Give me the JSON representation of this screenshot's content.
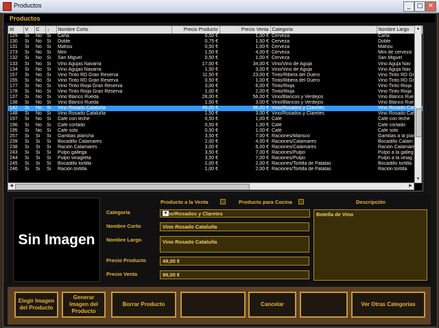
{
  "window": {
    "title": "Productos",
    "min": "_",
    "max": "□",
    "close": "✕"
  },
  "panel": {
    "title": "Productos"
  },
  "table": {
    "headers": [
      "Id",
      "V",
      "C",
      "↓",
      "Nombre Corto",
      "Precio Producto",
      "Precio Venta",
      "Categoria",
      "Nombre Largo"
    ],
    "rows": [
      [
        "129",
        "Si",
        "No",
        "Si",
        "Caña",
        "0,50 €",
        "1,00 €",
        "Cerveza",
        "Caña"
      ],
      [
        "130",
        "Si",
        "No",
        "Si",
        "Doble",
        "0,75 €",
        "1,50 €",
        "Cerveza",
        "Doble"
      ],
      [
        "131",
        "Si",
        "No",
        "Si",
        "Mahou",
        "0,50 €",
        "1,00 €",
        "Cerveza",
        "Mahou"
      ],
      [
        "273",
        "Si",
        "No",
        "Si",
        "Mini",
        "1,50 €",
        "4,00 €",
        "Cerveza",
        "Mini de cerveza"
      ],
      [
        "132",
        "Si",
        "No",
        "Si",
        "San Miguel",
        "0,50 €",
        "1,00 €",
        "Cerveza",
        "San Miguel"
      ],
      [
        "133",
        "Si",
        "No",
        "Si",
        "Vino Agujas Navarra",
        "17,00 €",
        "34,00 €",
        "Vino/Vino de Aguja",
        "Vino Aguja Nav"
      ],
      [
        "134",
        "Si",
        "No",
        "Si",
        "Vino Agujas Navarra",
        "1,50 €",
        "3,00 €",
        "Vino/Vino de Aguja",
        "Vino Aguja Nav"
      ],
      [
        "157",
        "Si",
        "No",
        "Si",
        "Vino Tinto RD Gran Reserva",
        "11,50 €",
        "23,00 €",
        "Tinto/Ribera del Duero",
        "Vino Tinto RD Gr"
      ],
      [
        "155",
        "Si",
        "No",
        "Si",
        "Vino Tinto RD Gran Reserva",
        "0,50 €",
        "1,00 €",
        "Tinto/Ribera del Duero",
        "Vino Tinto RD Gr"
      ],
      [
        "177",
        "Si",
        "No",
        "Si",
        "Vino Tinto Rioja Gran Reserva",
        "3,00 €",
        "6,00 €",
        "Tinto/Rioja",
        "Vino Tinto Rioja"
      ],
      [
        "178",
        "Si",
        "No",
        "Si",
        "Vino Tinto Rioja Gran Reserva",
        "1,00 €",
        "2,00 €",
        "Tinto/Rioja",
        "Vino Tinto Rioja"
      ],
      [
        "137",
        "Si",
        "No",
        "Si",
        "Vino Blanco Rueda",
        "28,00 €",
        "56,00 €",
        "Vino/Blancos y Verdejos",
        "Vino Blanco Rue"
      ],
      [
        "138",
        "Si",
        "No",
        "Si",
        "Vino Blanco Rueda",
        "1,50 €",
        "3,00 €",
        "Vino/Blancos y Verdejos",
        "Vino Blanco Rue"
      ],
      [
        "142",
        "Si",
        "No",
        "Si",
        "Vino Rosado Cataluña",
        "49,00 €",
        "98,00 €",
        "Vino/Rosados y Claretes",
        "Vino Rosado Cat"
      ],
      [
        "148",
        "Si",
        "No",
        "Si",
        "Vino Rosado Cataluña",
        "1,50 €",
        "3,00 €",
        "Vino/Rosados y Claretes",
        "Vino Rosado Cat"
      ],
      [
        "197",
        "Si",
        "No",
        "Si",
        "Cafe con leche",
        "0,50 €",
        "1,00 €",
        "Café",
        "Cafe con leche"
      ],
      [
        "196",
        "Si",
        "No",
        "Si",
        "Cafe cortado",
        "0,50 €",
        "1,00 €",
        "Café",
        "Cafe cortado"
      ],
      [
        "195",
        "Si",
        "No",
        "Si",
        "Cafe solo",
        "0,50 €",
        "1,00 €",
        "Café",
        "Cafe solo"
      ],
      [
        "257",
        "Si",
        "Si",
        "Si",
        "Gambas plancha",
        "3,50 €",
        "7,00 €",
        "Raciones/Marisco",
        "Gambas a la plan"
      ],
      [
        "239",
        "Si",
        "Si",
        "Si",
        "Bocadillo Calamares",
        "2,00 €",
        "4,00 €",
        "Raciones/Calamares",
        "Bocadillo Calam"
      ],
      [
        "238",
        "Si",
        "Si",
        "Si",
        "Ración Calamares",
        "3,00 €",
        "6,00 €",
        "Raciones/Calamares",
        "Ración Calamare"
      ],
      [
        "243",
        "Si",
        "Si",
        "Si",
        "Pulpo gallega",
        "3,50 €",
        "7,00 €",
        "Raciones/Pulpo",
        "Pulpo a la galleg"
      ],
      [
        "244",
        "Si",
        "Si",
        "Si",
        "Pulpo vinagreta",
        "3,50 €",
        "7,00 €",
        "Raciones/Pulpo",
        "Pulpo a la vinag"
      ],
      [
        "245",
        "Si",
        "Si",
        "Si",
        "Bocadillo tortilla",
        "1,00 €",
        "2,00 €",
        "Raciones/Tortilla de Patatas",
        "Bocadillo tortilla"
      ],
      [
        "246",
        "Si",
        "Si",
        "Si",
        "Ración tortilla",
        "1,00 €",
        "2,00 €",
        "Raciones/Tortilla de Patatas",
        "Ración tortilla"
      ]
    ],
    "selected_index": 13
  },
  "detail": {
    "image_placeholder": "Sin Imagen",
    "producto_venta_label": "Producto a la Venta",
    "producto_cocina_label": "Producto para Cocina",
    "descripcion_label": "Descripción",
    "categoria_label": "Categoria",
    "categoria_value": "Vino/Rosados y Claretes",
    "nombre_corto_label": "Nombre Corto",
    "nombre_corto_value": "Vino Rosado Cataluña",
    "nombre_largo_label": "Nombre Largo",
    "nombre_largo_value": "Vino Rosado Cataluña",
    "precio_producto_label": "Precio Producto",
    "precio_producto_value": "49,00 €",
    "precio_venta_label": "Precio Venta",
    "precio_venta_value": "98,00 €",
    "descripcion_value": "Botella de Vino"
  },
  "buttons": {
    "elegir": "Elegir Imagen del Producto",
    "generar": "Generar Imagen del Producto",
    "borrar": "Borrar Producto",
    "blank1": "",
    "cancelar": "Cancelar",
    "blank2": "",
    "ver_otras": "Ver Otras Categorias"
  }
}
